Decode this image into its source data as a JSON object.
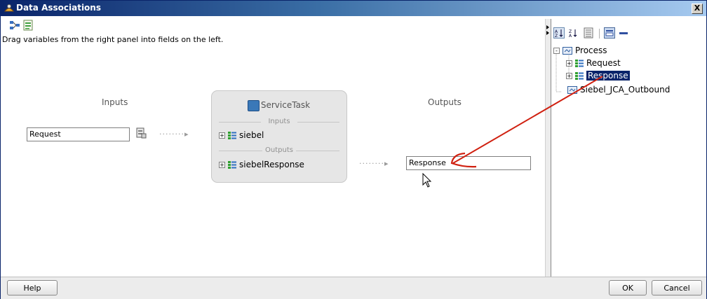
{
  "window": {
    "title": "Data Associations",
    "close_glyph": "X"
  },
  "instruction": "Drag variables from the right panel into fields on the left.",
  "inputs_label": "Inputs",
  "outputs_label": "Outputs",
  "input_field_value": "Request",
  "output_field_value": "Response",
  "dots": "········▸",
  "service": {
    "title": "ServiceTask",
    "inputs_label": "Inputs",
    "outputs_label": "Outputs",
    "input_item": "siebel",
    "output_item": "siebelResponse"
  },
  "tree": {
    "root": "Process",
    "items": [
      "Request",
      "Response"
    ],
    "other": "Siebel_JCA_Outbound"
  },
  "buttons": {
    "help": "Help",
    "ok": "OK",
    "cancel": "Cancel"
  },
  "colors": {
    "title_bar": "#0a246a",
    "selection": "#0a246a",
    "annotation_arrow": "#d02010",
    "service_box": "#e6e6e6"
  },
  "icons": [
    "data-associations-icon",
    "auto-map-icon",
    "expression-builder-icon",
    "sort-ascending-icon",
    "sort-descending-icon",
    "list-view-icon",
    "collapse-panel-icon"
  ]
}
